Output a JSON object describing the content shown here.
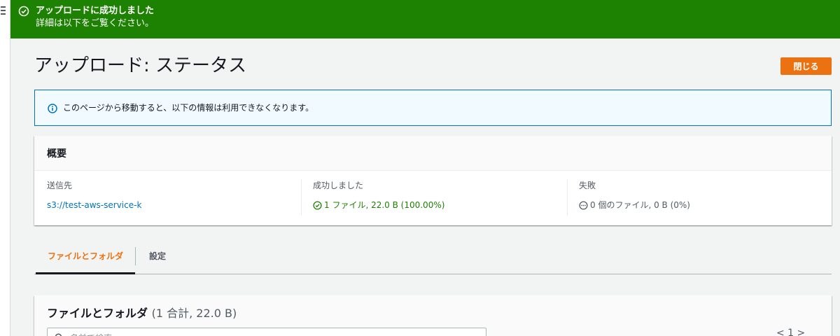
{
  "flash": {
    "title": "アップロードに成功しました",
    "subtitle": "詳細は以下をご覧ください。",
    "color": "#1d8102"
  },
  "header": {
    "title": "アップロード: ステータス",
    "close_label": "閉じる",
    "accent": "#ec7211"
  },
  "info": {
    "text": "このページから移動すると、以下の情報は利用できなくなります。"
  },
  "summary": {
    "title": "概要",
    "destination": {
      "label": "送信先",
      "value": "s3://test-aws-service-k"
    },
    "succeeded": {
      "label": "成功しました",
      "value": "1 ファイル, 22.0 B (100.00%)"
    },
    "failed": {
      "label": "失敗",
      "value": "0 個のファイル, 0 B (0%)"
    }
  },
  "tabs": [
    {
      "label": "ファイルとフォルダ",
      "active": true
    },
    {
      "label": "設定",
      "active": false
    }
  ],
  "files": {
    "title": "ファイルとフォルダ",
    "count": "(1 合計, 22.0 B)",
    "search_placeholder": "名前で検索",
    "pager": "<  1  >"
  }
}
